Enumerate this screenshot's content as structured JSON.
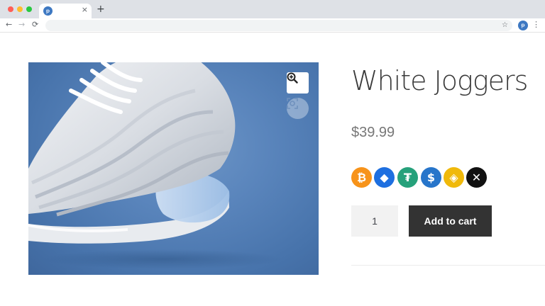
{
  "browser": {
    "tab_favicon_glyph": "ᵽ",
    "tab_close_glyph": "×",
    "new_tab_glyph": "+",
    "nav_back_glyph": "←",
    "nav_forward_glyph": "→",
    "nav_reload_glyph": "⟳",
    "bookmark_glyph": "☆",
    "profile_glyph": "ᵽ",
    "menu_glyph": "⋮",
    "traffic_light_colors": [
      "#ff5f57",
      "#febc2e",
      "#28c840"
    ]
  },
  "product": {
    "title": "White Joggers",
    "price": "$39.99",
    "image_alt_icon": "sneaker-image",
    "zoom_icon": "magnify-plus-icon",
    "scan_icon": "camera-scan-icon",
    "quantity": "1",
    "add_to_cart_label": "Add to cart",
    "image_background": "#4f7bb5"
  },
  "crypto": [
    {
      "name": "bitcoin",
      "glyph": "₿",
      "color": "#f7931a"
    },
    {
      "name": "ethereum",
      "glyph": "◆",
      "color": "#1e6fe0"
    },
    {
      "name": "tether",
      "glyph": "₮",
      "color": "#26a17b"
    },
    {
      "name": "usd-coin",
      "glyph": "$",
      "color": "#2775ca"
    },
    {
      "name": "binance-usd",
      "glyph": "◈",
      "color": "#f0b90b"
    },
    {
      "name": "xrp",
      "glyph": "✕",
      "color": "#111111"
    }
  ]
}
